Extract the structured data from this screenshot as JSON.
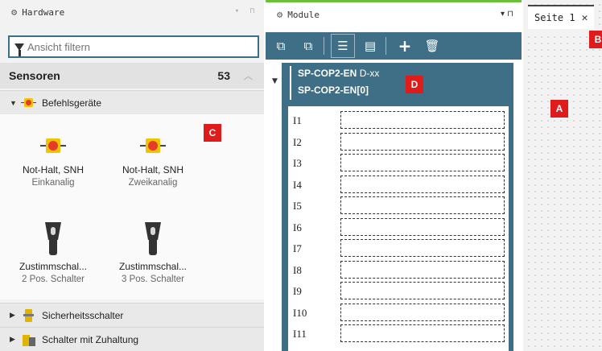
{
  "hardware": {
    "title": "Hardware",
    "filter_placeholder": "Ansicht filtern",
    "category": {
      "label": "Sensoren",
      "count": "53"
    },
    "subcategory_open": "Befehlsgeräte",
    "tiles": [
      {
        "title": "Not-Halt, SNH",
        "subtitle": "Einkanalig"
      },
      {
        "title": "Not-Halt, SNH",
        "subtitle": "Zweikanalig"
      },
      {
        "title": "Zustimmschal...",
        "subtitle": "2 Pos. Schalter"
      },
      {
        "title": "Zustimmschal...",
        "subtitle": "3 Pos. Schalter"
      }
    ],
    "subcategories_closed": [
      "Sicherheitsschalter",
      "Schalter mit Zuhaltung"
    ]
  },
  "module": {
    "title": "Module",
    "name_bold": "SP-COP2-EN",
    "name_suffix": " D-xx",
    "instance": "SP-COP2-EN[0]",
    "inputs": [
      "I1",
      "I2",
      "I3",
      "I4",
      "I5",
      "I6",
      "I7",
      "I8",
      "I9",
      "I10",
      "I11"
    ]
  },
  "seite": {
    "tab_label": "Seite 1",
    "close_glyph": "✕"
  },
  "markers": {
    "a": "A",
    "b": "B",
    "c": "C",
    "d": "D"
  },
  "colors": {
    "accent_green": "#6bbf3b",
    "module_blue": "#3e6f87",
    "marker_red": "#e01b1b",
    "estop_yellow": "#f0c400",
    "estop_red": "#e53b2b"
  },
  "icons": {
    "panel": "gear-icon",
    "filter": "funnel-icon",
    "close": "close-icon"
  }
}
